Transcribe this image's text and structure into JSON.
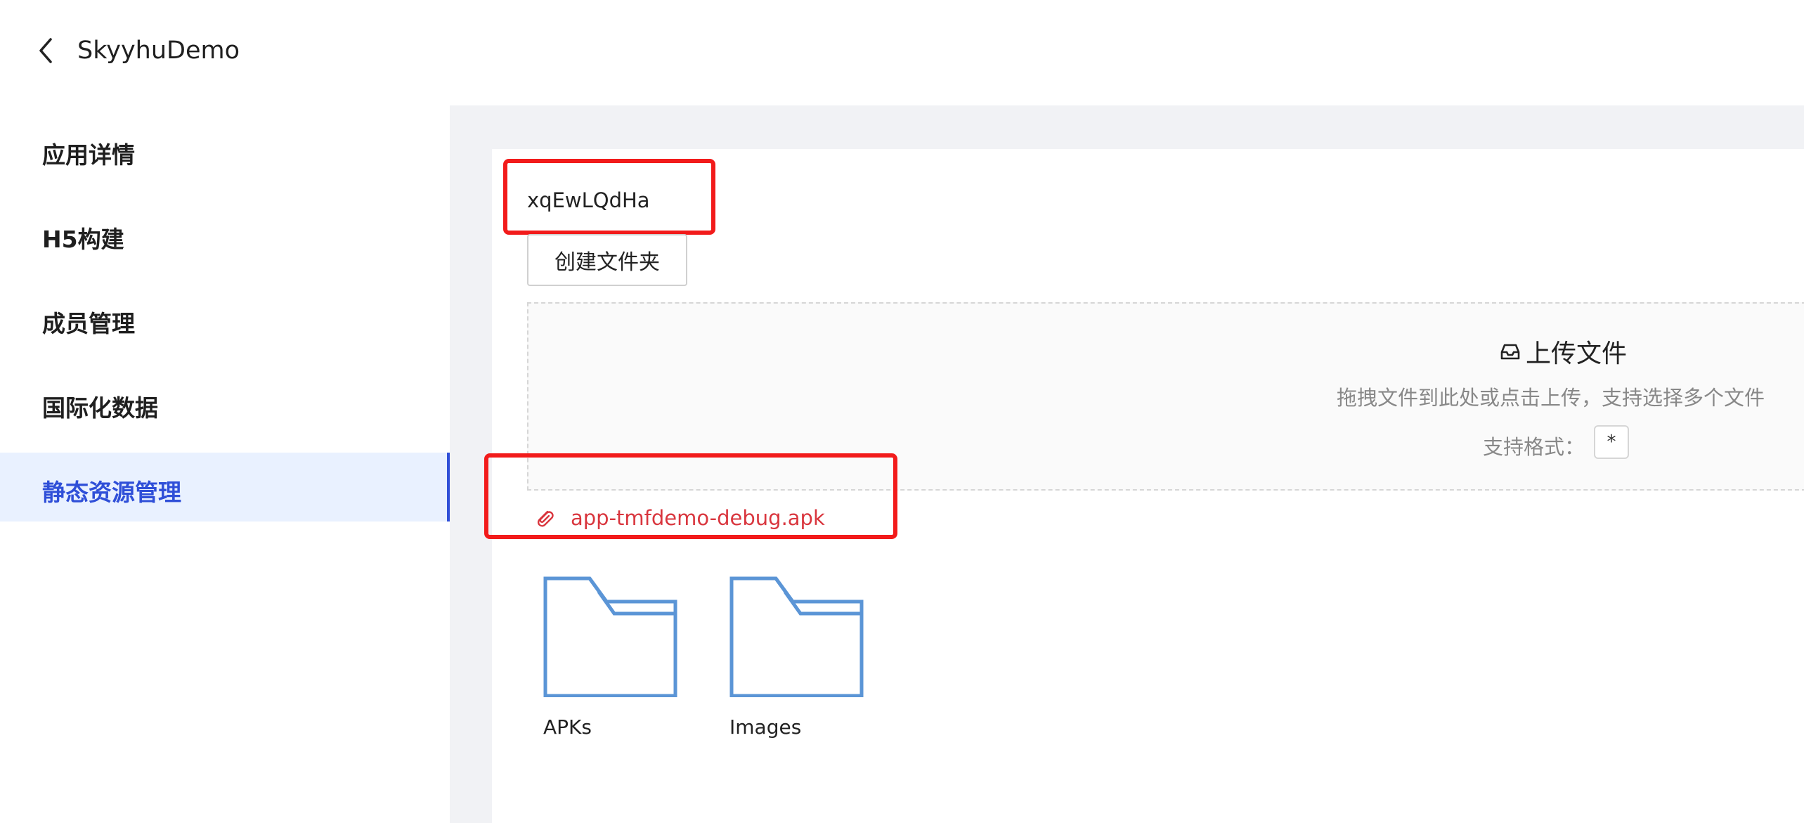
{
  "header": {
    "title": "SkyyhuDemo",
    "back_icon": "chevron-left-icon"
  },
  "sidebar": {
    "items": [
      {
        "label": "应用详情"
      },
      {
        "label": "H5构建"
      },
      {
        "label": "成员管理"
      },
      {
        "label": "国际化数据"
      },
      {
        "label": "静态资源管理",
        "active": true
      }
    ],
    "active_color": "#2f4fd8",
    "active_bg": "#e9f1ff"
  },
  "main": {
    "folder_name": "xqEwLQdHa",
    "create_folder_label": "创建文件夹",
    "upload": {
      "icon": "inbox-icon",
      "title": "上传文件",
      "hint": "拖拽文件到此处或点击上传，支持选择多个文件",
      "formats_label": "支持格式：",
      "formats_value": "*"
    },
    "file": {
      "icon": "paperclip-icon",
      "name": "app-tmfdemo-debug.apk",
      "color": "#d9363e"
    },
    "folders": [
      {
        "name": "APKs",
        "icon": "folder-icon"
      },
      {
        "name": "Images",
        "icon": "folder-icon"
      }
    ],
    "folder_icon_color": "#5b95d6",
    "highlight_color": "#f21b1b"
  }
}
